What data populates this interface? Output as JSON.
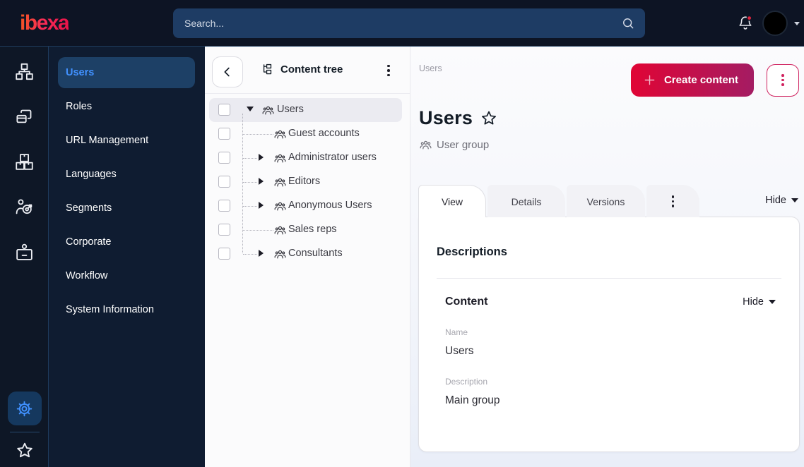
{
  "topbar": {
    "logo": "ibexa",
    "search_placeholder": "Search..."
  },
  "sidebar": {
    "items": [
      "Users",
      "Roles",
      "URL Management",
      "Languages",
      "Segments",
      "Corporate",
      "Workflow",
      "System Information"
    ],
    "active": "Users"
  },
  "tree": {
    "title": "Content tree",
    "rows": [
      {
        "label": "Users",
        "level": 0,
        "state": "expanded",
        "selected": true
      },
      {
        "label": "Guest accounts",
        "level": 1,
        "state": "leaf"
      },
      {
        "label": "Administrator users",
        "level": 1,
        "state": "collapsed"
      },
      {
        "label": "Editors",
        "level": 1,
        "state": "collapsed"
      },
      {
        "label": "Anonymous Users",
        "level": 1,
        "state": "collapsed"
      },
      {
        "label": "Sales reps",
        "level": 1,
        "state": "leaf"
      },
      {
        "label": "Consultants",
        "level": 1,
        "state": "collapsed"
      }
    ]
  },
  "main": {
    "breadcrumb": "Users",
    "create_button": "Create content",
    "title": "Users",
    "content_type": "User group",
    "tabs": [
      "View",
      "Details",
      "Versions"
    ],
    "active_tab": "View",
    "collapse_label": "Hide",
    "card": {
      "heading": "Descriptions",
      "section_title": "Content",
      "section_collapse_label": "Hide",
      "fields": [
        {
          "label": "Name",
          "value": "Users"
        },
        {
          "label": "Description",
          "value": "Main group"
        }
      ]
    }
  },
  "colors": {
    "brand_red": "#e00535",
    "brand_magenta": "#a41c63",
    "active_blue": "#4191ff",
    "topbar_bg": "#0d1424",
    "search_bg": "#1e3c64",
    "notification_dot": "#e0243f"
  }
}
